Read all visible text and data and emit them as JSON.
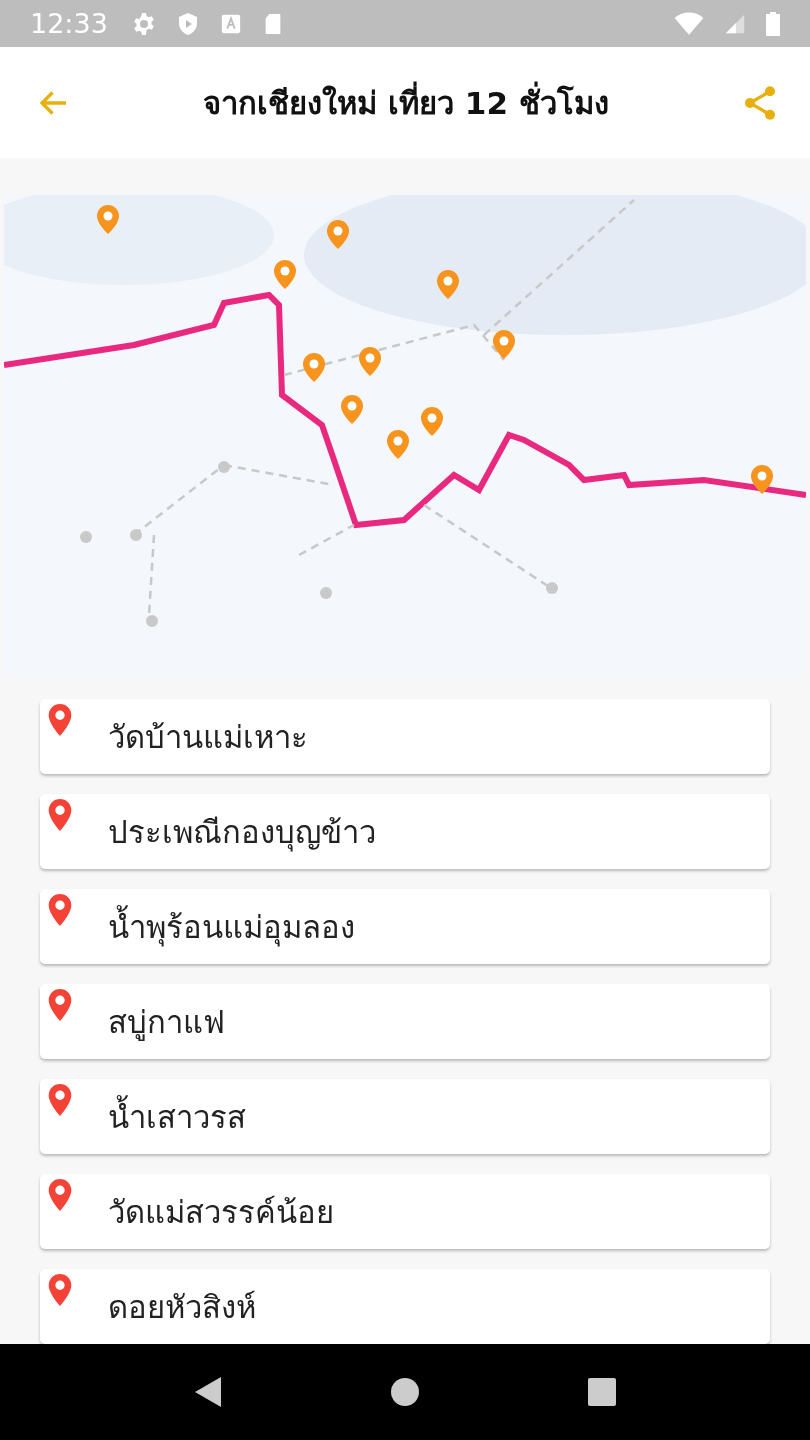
{
  "status_bar": {
    "time": "12:33"
  },
  "header": {
    "title": "จากเชียงใหม่ เที่ยว 12 ชั่วโมง"
  },
  "places": [
    {
      "name": "วัดบ้านแม่เหาะ"
    },
    {
      "name": "ประเพณีกองบุญข้าว"
    },
    {
      "name": "น้ำพุร้อนแม่อุมลอง"
    },
    {
      "name": "สบู่กาแฟ"
    },
    {
      "name": "น้ำเสาวรส"
    },
    {
      "name": "วัดแม่สวรรค์น้อย"
    },
    {
      "name": "ดอยหัวสิงห์"
    }
  ]
}
